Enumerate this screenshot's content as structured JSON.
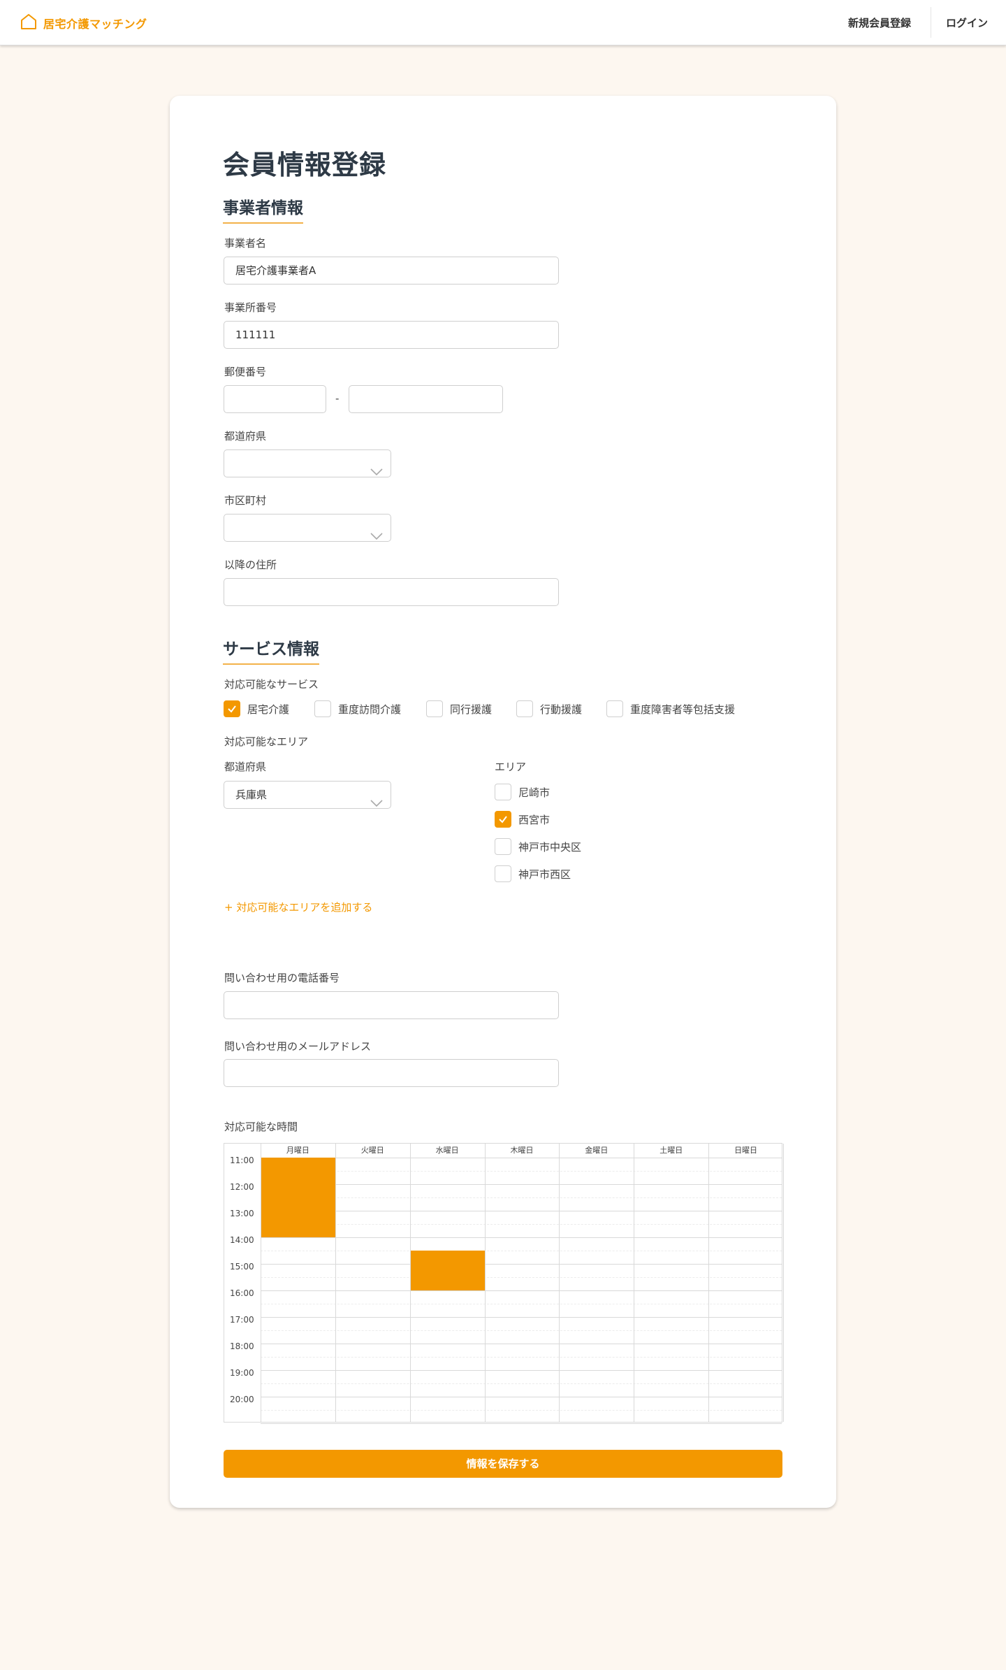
{
  "header": {
    "brand_name": "居宅介護マッチング",
    "nav_register": "新規会員登録",
    "nav_login": "ログイン"
  },
  "page": {
    "title": "会員情報登録"
  },
  "business": {
    "section_title": "事業者情報",
    "name_label": "事業者名",
    "name_value": "居宅介護事業者A",
    "office_no_label": "事業所番号",
    "office_no_value": "111111",
    "postal_label": "郵便番号",
    "postal_first": "",
    "postal_second": "",
    "postal_sep": "-",
    "prefecture_label": "都道府県",
    "prefecture_value": "",
    "city_label": "市区町村",
    "city_value": "",
    "address_label": "以降の住所",
    "address_value": ""
  },
  "service": {
    "section_title": "サービス情報",
    "services_label": "対応可能なサービス",
    "services": [
      {
        "label": "居宅介護",
        "checked": true
      },
      {
        "label": "重度訪問介護",
        "checked": false
      },
      {
        "label": "同行援護",
        "checked": false
      },
      {
        "label": "行動援護",
        "checked": false
      },
      {
        "label": "重度障害者等包括支援",
        "checked": false
      }
    ],
    "area_label": "対応可能なエリア",
    "area_prefecture_label": "都道府県",
    "area_prefecture_value": "兵庫県",
    "area_list_label": "エリア",
    "areas": [
      {
        "label": "尼崎市",
        "checked": false
      },
      {
        "label": "西宮市",
        "checked": true
      },
      {
        "label": "神戸市中央区",
        "checked": false
      },
      {
        "label": "神戸市西区",
        "checked": false
      }
    ],
    "add_area_link": "+ 対応可能なエリアを追加する"
  },
  "contact": {
    "phone_label": "問い合わせ用の電話番号",
    "phone_value": "",
    "email_label": "問い合わせ用のメールアドレス",
    "email_value": ""
  },
  "schedule": {
    "label": "対応可能な時間",
    "days": [
      "月曜日",
      "火曜日",
      "水曜日",
      "木曜日",
      "金曜日",
      "土曜日",
      "日曜日"
    ],
    "times": [
      "11:00",
      "12:00",
      "13:00",
      "14:00",
      "15:00",
      "16:00",
      "17:00",
      "18:00",
      "19:00",
      "20:00"
    ],
    "blocks": [
      {
        "day": 0,
        "start": "11:00",
        "end": "14:00"
      },
      {
        "day": 2,
        "start": "14:30",
        "end": "16:00"
      }
    ]
  },
  "save_button": "情報を保存する",
  "colors": {
    "accent": "#f39800",
    "background": "#fdf7f0",
    "heading": "#2e3a46"
  }
}
